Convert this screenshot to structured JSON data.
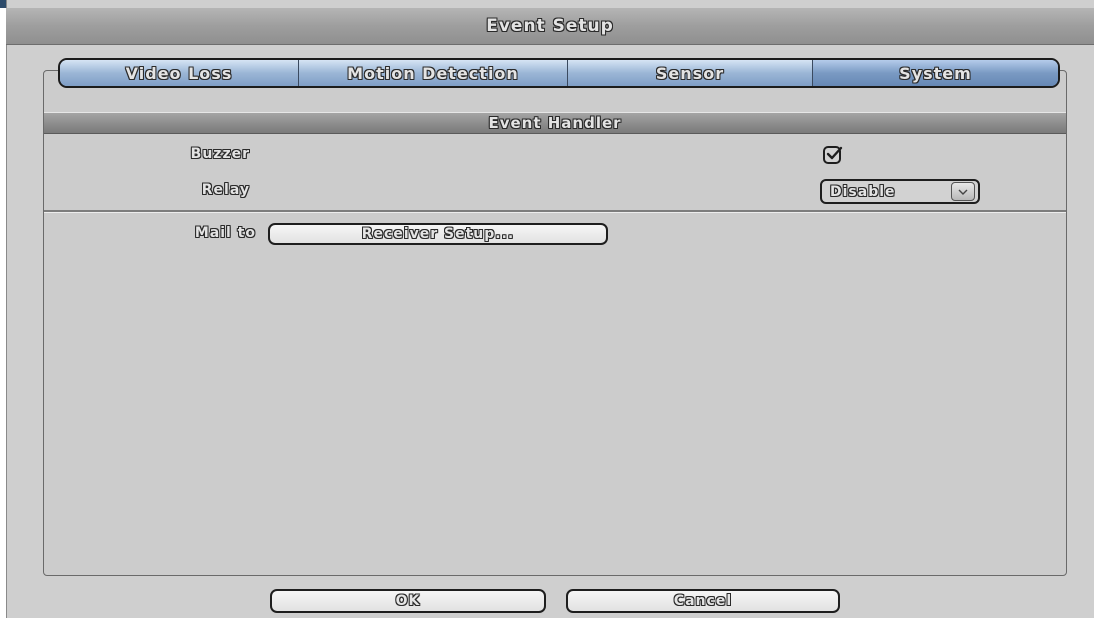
{
  "window": {
    "title": "Event Setup"
  },
  "tabs": [
    {
      "label": "Video Loss"
    },
    {
      "label": "Motion Detection"
    },
    {
      "label": "Sensor"
    },
    {
      "label": "System"
    }
  ],
  "active_tab": "System",
  "section": {
    "title": "Event Handler"
  },
  "buzzer": {
    "label": "Buzzer",
    "checked": true
  },
  "relay": {
    "label": "Relay",
    "value": "Disable"
  },
  "mail": {
    "label": "Mail to",
    "button_label": "Receiver Setup..."
  },
  "footer": {
    "ok_label": "OK",
    "cancel_label": "Cancel"
  },
  "icons": {
    "checkbox": "check-icon",
    "dropdown_arrow": "chevron-down-icon"
  },
  "colors": {
    "tab_active": "#7a9ac3",
    "panel_bg": "#cccccc"
  }
}
